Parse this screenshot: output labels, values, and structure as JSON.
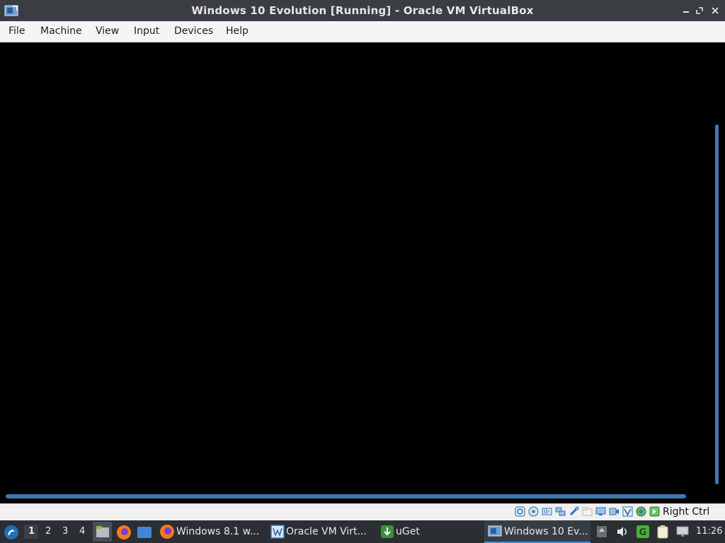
{
  "window": {
    "title": "Windows 10 Evolution [Running] - Oracle VM VirtualBox"
  },
  "menu": {
    "items": [
      "File",
      "Machine",
      "View",
      "Input",
      "Devices",
      "Help"
    ]
  },
  "statusbar": {
    "host_key": "Right Ctrl"
  },
  "taskbar": {
    "workspaces": [
      "1",
      "2",
      "3",
      "4"
    ],
    "active_workspace": "1",
    "tasks": [
      {
        "label": "Windows 8.1 w..."
      },
      {
        "label": "Oracle VM Virt..."
      },
      {
        "label": "uGet"
      },
      {
        "label": "Windows 10 Ev..."
      }
    ],
    "clock": "11:26"
  },
  "colors": {
    "titlebar": "#3a3e43",
    "menubar": "#f5f5f5",
    "scrollbar": "#3d79b2",
    "taskbar": "#2b2f33"
  }
}
